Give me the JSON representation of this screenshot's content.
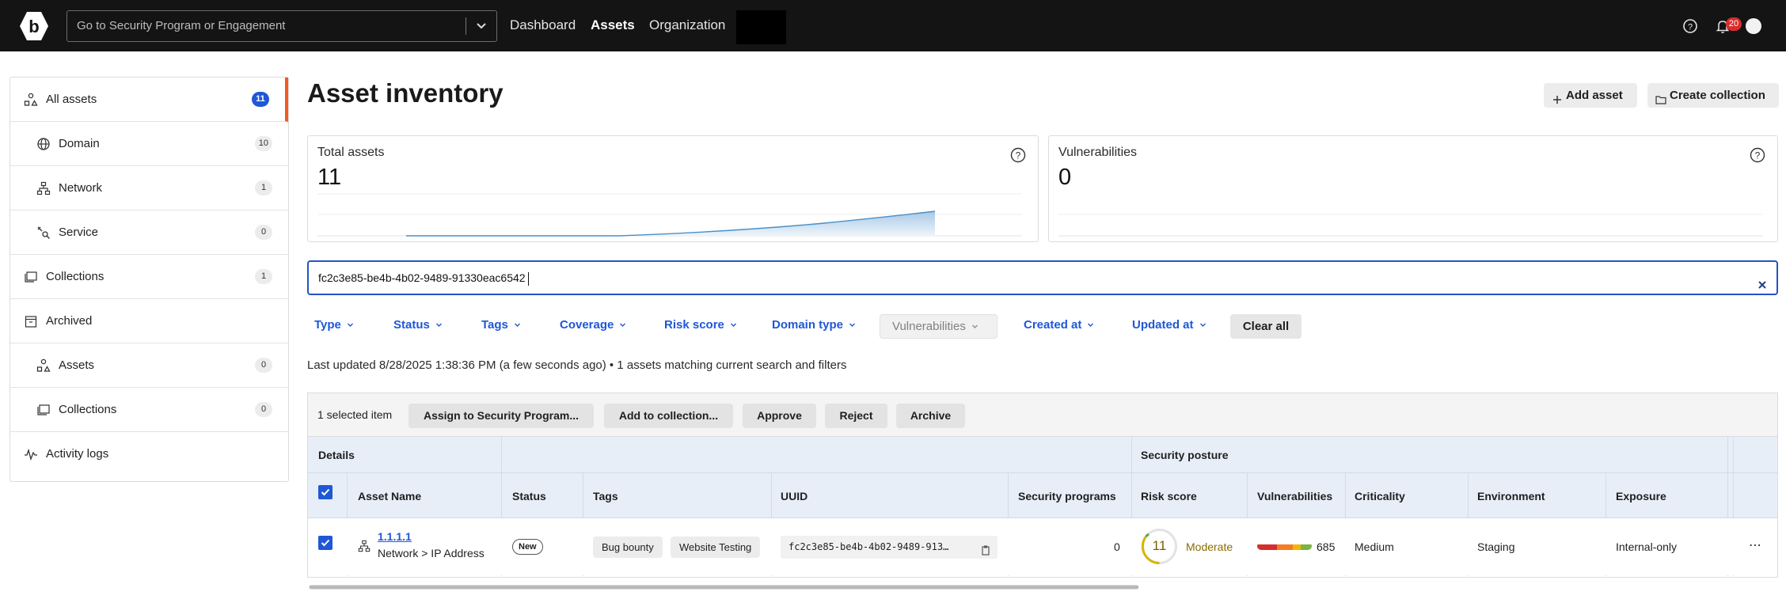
{
  "topbar": {
    "logo_letter": "b",
    "search_placeholder": "Go to Security Program or Engagement",
    "nav": [
      {
        "label": "Dashboard"
      },
      {
        "label": "Assets"
      },
      {
        "label": "Organization"
      }
    ],
    "notification_count": "20"
  },
  "sidebar": {
    "items": [
      {
        "label": "All assets",
        "count": "11",
        "icon": "assets-icon"
      },
      {
        "label": "Domain",
        "count": "10",
        "icon": "globe-icon"
      },
      {
        "label": "Network",
        "count": "1",
        "icon": "network-icon"
      },
      {
        "label": "Service",
        "count": "0",
        "icon": "service-icon"
      },
      {
        "label": "Collections",
        "count": "1",
        "icon": "collections-icon"
      },
      {
        "label": "Archived",
        "icon": "archive-icon"
      },
      {
        "label": "Assets",
        "count": "0",
        "icon": "assets-icon"
      },
      {
        "label": "Collections",
        "count": "0",
        "icon": "collections-icon"
      },
      {
        "label": "Activity logs",
        "icon": "activity-icon"
      }
    ]
  },
  "header": {
    "title": "Asset inventory",
    "add_asset": "Add asset",
    "create_collection": "Create collection"
  },
  "cards": {
    "total_label": "Total assets",
    "total_value": "11",
    "vuln_label": "Vulnerabilities",
    "vuln_value": "0"
  },
  "filter": {
    "value": "fc2c3e85-be4b-4b02-9489-91330eac6542"
  },
  "filters": {
    "type": "Type",
    "status": "Status",
    "tags": "Tags",
    "coverage": "Coverage",
    "risk_score": "Risk score",
    "domain_type": "Domain type",
    "vulnerabilities": "Vulnerabilities",
    "created_at": "Created at",
    "updated_at": "Updated at",
    "clear_all": "Clear all"
  },
  "status_line": "Last updated 8/28/2025 1:38:36 PM (a few seconds ago) • 1 assets matching current search and filters",
  "bulk": {
    "selected": "1 selected item",
    "assign": "Assign to Security Program...",
    "add_collection": "Add to collection...",
    "approve": "Approve",
    "reject": "Reject",
    "archive": "Archive"
  },
  "table": {
    "group_details": "Details",
    "group_posture": "Security posture",
    "columns": {
      "asset_name": "Asset Name",
      "status": "Status",
      "tags": "Tags",
      "uuid": "UUID",
      "security_programs": "Security programs",
      "risk_score": "Risk score",
      "vulnerabilities": "Vulnerabilities",
      "criticality": "Criticality",
      "environment": "Environment",
      "exposure": "Exposure"
    },
    "row": {
      "name": "1.1.1.1",
      "type": "Network > IP Address",
      "status": "New",
      "tags": [
        "Bug bounty",
        "Website Testing"
      ],
      "uuid": "fc2c3e85-be4b-4b02-9489-913…",
      "security_programs": "0",
      "risk_score": "11",
      "risk_label": "Moderate",
      "vulnerabilities": "685",
      "criticality": "Medium",
      "environment": "Staging",
      "exposure": "Internal-only",
      "more": "⋯"
    }
  },
  "colors": {
    "accent": "#1f57d6",
    "active_marker": "#f15a22",
    "moderate": "#8a6d00"
  }
}
